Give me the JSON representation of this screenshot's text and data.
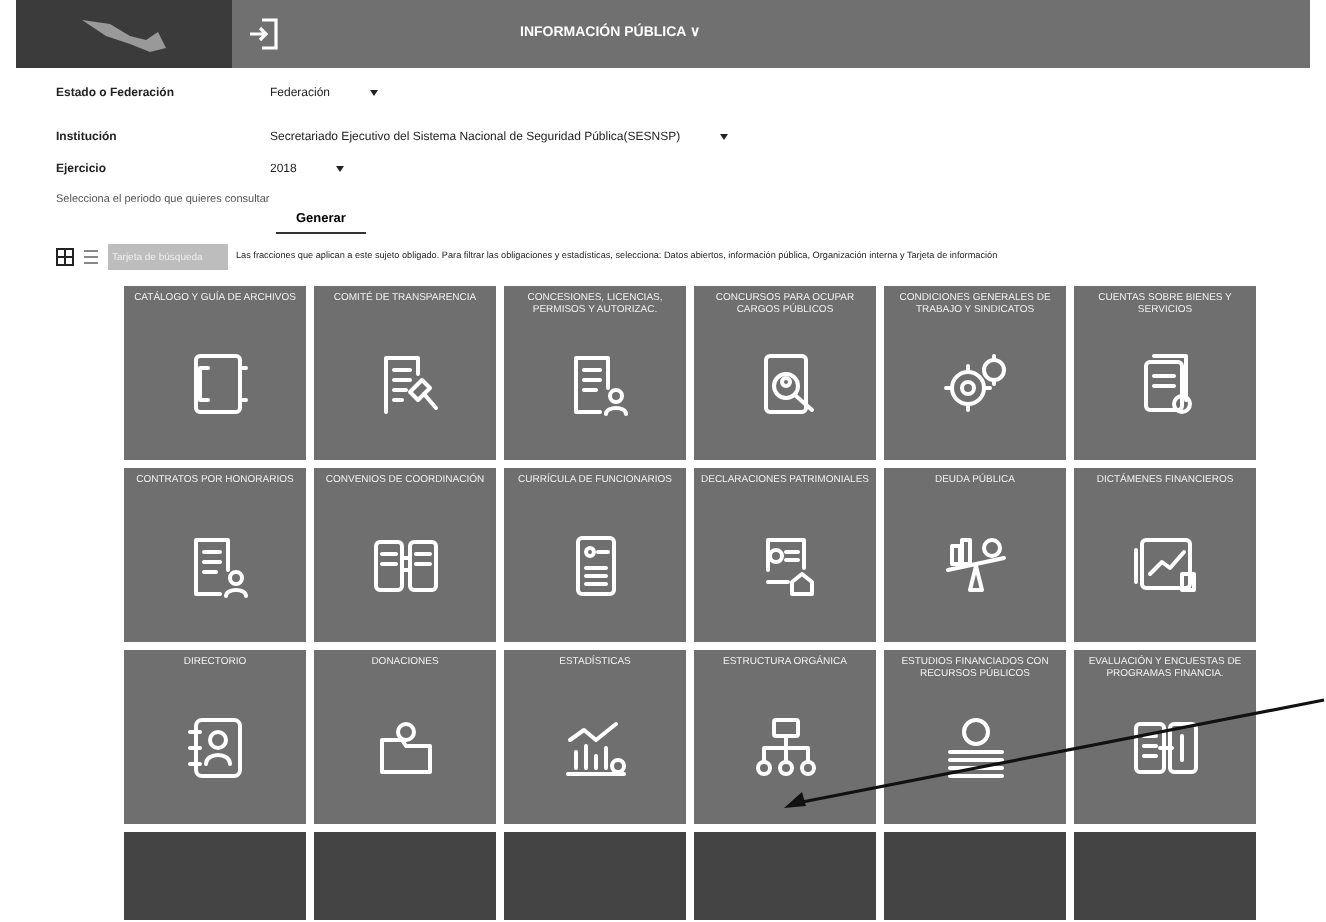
{
  "header": {
    "title": "INFORMACIÓN PÚBLICA ∨"
  },
  "form": {
    "fields": [
      {
        "label": "Estado o Federación",
        "value": "Federación",
        "kind": "select"
      },
      {
        "label": "Institución",
        "value": "Secretariado Ejecutivo del Sistema Nacional de Seguridad Pública(SESNSP)",
        "kind": "select"
      },
      {
        "label": "Ejercicio",
        "value": "2018",
        "kind": "select"
      }
    ],
    "hint": "Selecciona el periodo que quieres consultar",
    "button": "Generar"
  },
  "view": {
    "grid_selected": true,
    "list_selected": false,
    "search_placeholder": "Tarjeta de búsqueda",
    "description": "Las fracciones que aplican a este sujeto obligado. Para filtrar las obligaciones y estadísticas, selecciona: Datos abiertos, información pública, Organización interna y Tarjeta de información"
  },
  "tiles": [
    {
      "title": "CATÁLOGO Y GUÍA DE ARCHIVOS"
    },
    {
      "title": "COMITÉ DE TRANSPARENCIA"
    },
    {
      "title": "CONCESIONES, LICENCIAS, PERMISOS Y AUTORIZAC."
    },
    {
      "title": "CONCURSOS PARA OCUPAR CARGOS PÚBLICOS"
    },
    {
      "title": "CONDICIONES GENERALES DE TRABAJO Y SINDICATOS"
    },
    {
      "title": "CUENTAS SOBRE BIENES Y SERVICIOS"
    },
    {
      "title": "CONTRATOS POR HONORARIOS"
    },
    {
      "title": "CONVENIOS DE COORDINACIÓN"
    },
    {
      "title": "CURRÍCULA DE FUNCIONARIOS"
    },
    {
      "title": "DECLARACIONES PATRIMONIALES"
    },
    {
      "title": "DEUDA PÚBLICA"
    },
    {
      "title": "DICTÁMENES FINANCIEROS"
    },
    {
      "title": "DIRECTORIO"
    },
    {
      "title": "DONACIONES"
    },
    {
      "title": "ESTADÍSTICAS"
    },
    {
      "title": "ESTRUCTURA ORGÁNICA"
    },
    {
      "title": "ESTUDIOS FINANCIADOS CON RECURSOS PÚBLICOS"
    },
    {
      "title": "EVALUACIÓN Y ENCUESTAS DE PROGRAMAS FINANCIA."
    }
  ],
  "cut_off_tiles": [
    {
      "kind": "tile"
    },
    {
      "kind": "tile"
    },
    {
      "kind": "tile"
    },
    {
      "kind": "tile"
    },
    {
      "kind": "tile"
    },
    {
      "kind": "tile"
    }
  ],
  "annotation": {
    "kind": "arrow"
  }
}
